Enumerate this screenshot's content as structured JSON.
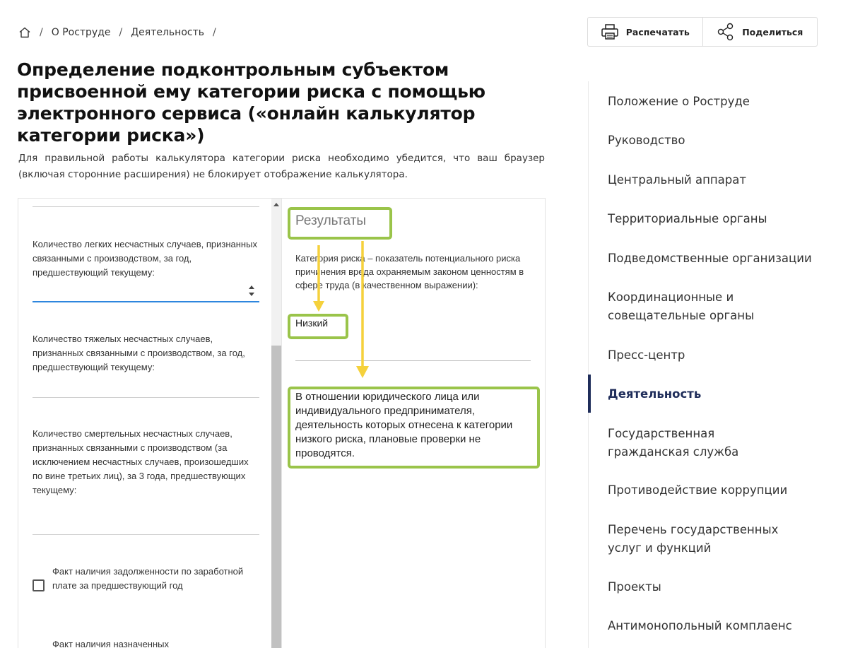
{
  "breadcrumb": {
    "items": [
      "О Роструде",
      "Деятельность"
    ],
    "separator": "/"
  },
  "actions": {
    "print_label": "Распечатать",
    "share_label": "Поделиться"
  },
  "page": {
    "title": "Определение подконтрольным субъектом присвоенной ему категории риска с помощью электронного сервиса («онлайн калькулятор категории риска»)",
    "intro": "Для правильной работы калькулятора категории риска необходимо убедится, что ваш браузер (включая сторонние расширения) не блокирует отображение калькулятора."
  },
  "calculator": {
    "fields": [
      {
        "label": "Количество легких несчастных случаев, признанных связанными с производством, за год, предшествующий текущему:",
        "value": ""
      },
      {
        "label": "Количество тяжелых несчастных случаев, признанных связанными с производством, за год, предшествующий текущему:",
        "value": ""
      },
      {
        "label": "Количество смертельных несчастных случаев, признанных связанными с производством (за исключением несчастных случаев, произошедших по вине третьих лиц), за 3 года, предшествующих текущему:",
        "value": ""
      }
    ],
    "checkbox_label": "Факт наличия задолженности по заработной плате за предшествующий год",
    "checkbox_checked": false,
    "next_label": "Факт наличия назначенных",
    "results": {
      "title": "Результаты",
      "description": "Категория риска – показатель потенциального риска причинения вреда охраняемым законом ценностям в сфере труда (в качественном выражении):",
      "value": "Низкий",
      "note": "В отношении юридического лица или индивидуального предпринимателя, деятельность которых отнесена к категории низкого риска, плановые проверки не проводятся."
    },
    "highlight_color": "#9ac44a",
    "arrow_color": "#f5d13c"
  },
  "sidenav": {
    "items": [
      {
        "label": "Положение о Роструде",
        "active": false
      },
      {
        "label": "Руководство",
        "active": false
      },
      {
        "label": "Центральный аппарат",
        "active": false
      },
      {
        "label": "Территориальные органы",
        "active": false
      },
      {
        "label": "Подведомственные организации",
        "active": false
      },
      {
        "label": "Координационные и совещательные органы",
        "active": false
      },
      {
        "label": "Пресс-центр",
        "active": false
      },
      {
        "label": "Деятельность",
        "active": true
      },
      {
        "label": "Государственная гражданская служба",
        "active": false
      },
      {
        "label": "Противодействие коррупции",
        "active": false
      },
      {
        "label": "Перечень государственных услуг и функций",
        "active": false
      },
      {
        "label": "Проекты",
        "active": false
      },
      {
        "label": "Антимонопольный комплаенс",
        "active": false
      }
    ],
    "accent_color": "#1f2d5a"
  }
}
